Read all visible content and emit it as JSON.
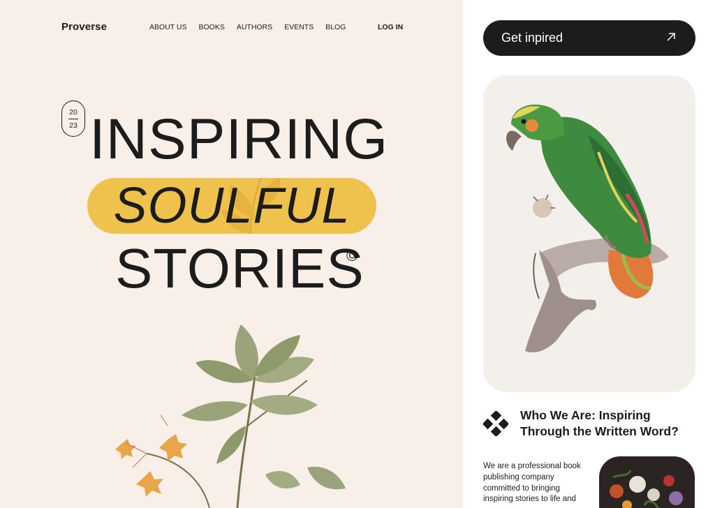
{
  "header": {
    "logo": "Proverse",
    "nav": [
      "ABOUT US",
      "BOOKS",
      "AUTHORS",
      "EVENTS",
      "BLOG"
    ],
    "login": "LOG IN"
  },
  "hero": {
    "year_top": "20",
    "year_bottom": "23",
    "line1": "INSPIRING",
    "line2": "SOULFUL",
    "line3": "STORIES",
    "copyright_symbol": "©"
  },
  "cta": {
    "label": "Get inpired",
    "icon": "arrow-up-right-icon"
  },
  "about": {
    "icon": "diamond-cluster-icon",
    "title": "Who We Are: Inspiring Through the Written Word?",
    "description": "We are a professional book publishing company committed to bringing inspiring stories to life and"
  },
  "colors": {
    "left_bg": "#f8f0e8",
    "accent_yellow": "#efc14d",
    "dark": "#1c1c1c",
    "card_bg": "#f3efea"
  }
}
